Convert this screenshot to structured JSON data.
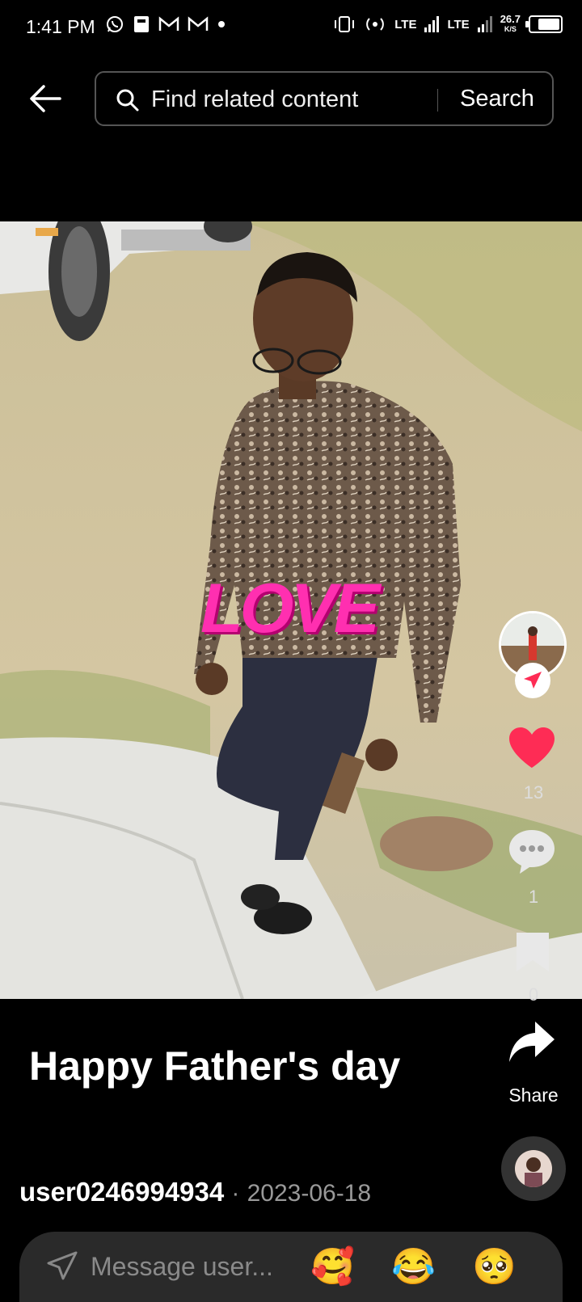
{
  "status_bar": {
    "time": "1:41 PM",
    "network_1": "LTE",
    "network_2": "LTE",
    "speed_value": "26.7",
    "speed_unit": "K/S"
  },
  "search": {
    "placeholder": "Find related content",
    "button_label": "Search"
  },
  "video": {
    "sticker_text": "LOVE"
  },
  "post": {
    "caption": "Happy Father's day",
    "author": "user0246994934",
    "separator": "·",
    "date": "2023-06-18"
  },
  "actions": {
    "like_count": "13",
    "comment_count": "1",
    "save_count": "0",
    "share_label": "Share"
  },
  "message_bar": {
    "placeholder": "Message user...",
    "emojis": [
      "🥰",
      "😂",
      "🥺"
    ]
  },
  "colors": {
    "like": "#fe2c55",
    "background": "#000000",
    "message_bar": "#2a2a2a"
  }
}
